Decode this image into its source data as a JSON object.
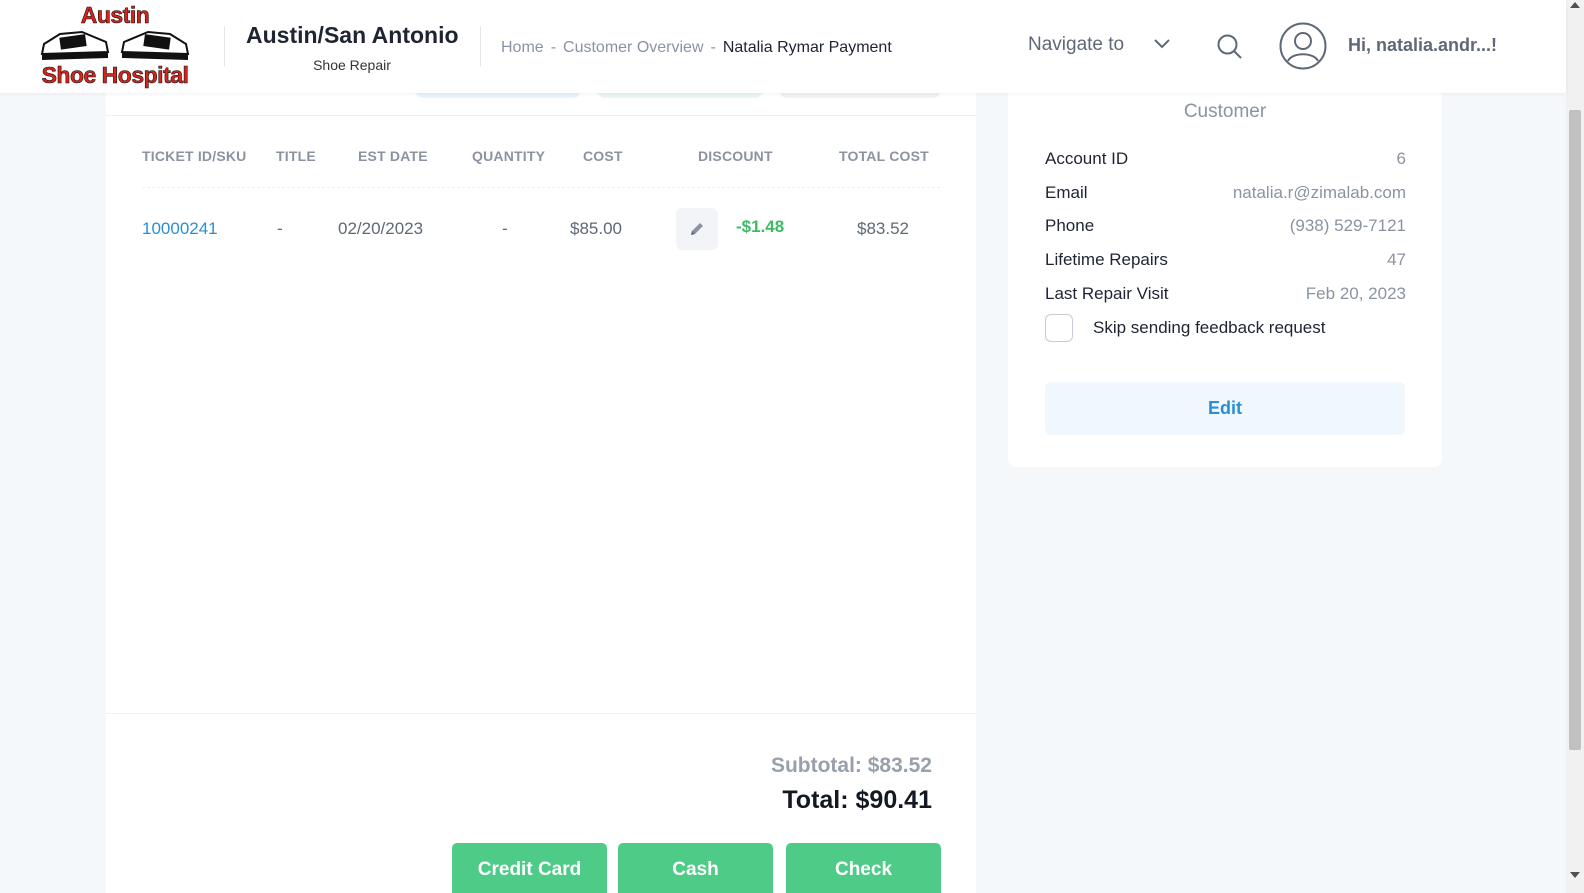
{
  "header": {
    "logo": {
      "top_text": "Austin",
      "bottom_text": "Shoe Hospital"
    },
    "store_name": "Austin/San Antonio",
    "store_subtitle": "Shoe Repair",
    "breadcrumb": [
      "Home",
      "Customer Overview",
      "Natalia Rymar Payment"
    ],
    "breadcrumb_separator": "-",
    "navigate_label": "Navigate to",
    "greeting": "Hi, natalia.andr...!"
  },
  "table": {
    "columns": [
      "TICKET ID/SKU",
      "TITLE",
      "EST DATE",
      "QUANTITY",
      "COST",
      "DISCOUNT",
      "TOTAL COST"
    ],
    "rows": [
      {
        "ticket_id": "10000241",
        "title": "-",
        "est_date": "02/20/2023",
        "quantity": "-",
        "cost": "$85.00",
        "discount": "-$1.48",
        "total_cost": "$83.52"
      }
    ]
  },
  "summary": {
    "subtotal": "Subtotal: $83.52",
    "total": "Total: $90.41"
  },
  "payment_buttons": [
    "Credit Card",
    "Cash",
    "Check"
  ],
  "customer": {
    "title": "Customer",
    "fields": [
      {
        "label": "Account ID",
        "value": "6"
      },
      {
        "label": "Email",
        "value": "natalia.r@zimalab.com"
      },
      {
        "label": "Phone",
        "value": "(938) 529-7121"
      },
      {
        "label": "Lifetime Repairs",
        "value": "47"
      },
      {
        "label": "Last Repair Visit",
        "value": "Feb 20, 2023"
      }
    ],
    "skip_feedback_label": "Skip sending feedback request",
    "skip_feedback_checked": false,
    "edit_label": "Edit"
  },
  "colors": {
    "accent_blue": "#2a8fd4",
    "pay_green": "#4ecb86",
    "discount_green": "#3fb964",
    "logo_red": "#d8231b"
  }
}
